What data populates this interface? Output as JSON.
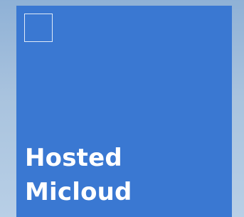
{
  "tile": {
    "label_line1": "Hosted",
    "label_line2": "Micloud",
    "icon": "square-outline-icon",
    "color": "#3a78d2"
  },
  "background_color": "#a9c3de"
}
